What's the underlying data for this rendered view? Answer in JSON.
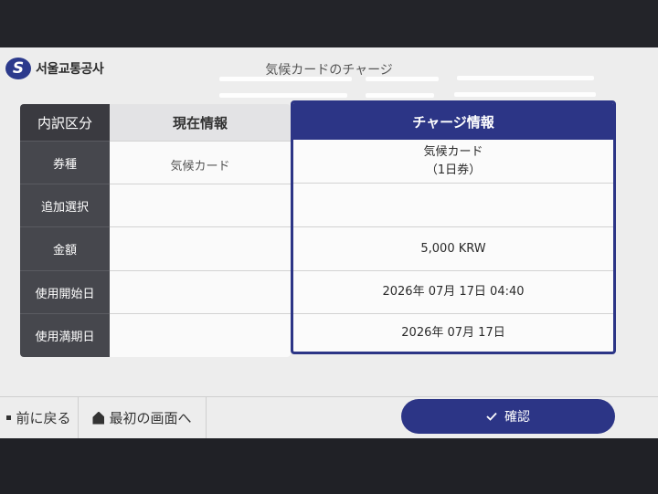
{
  "header": {
    "logo_mark": "S",
    "logo_text": "서울교통공사",
    "title": "気候カードのチャージ"
  },
  "table": {
    "label_header": "内訳区分",
    "current_header": "現在情報",
    "charge_header": "チャージ情報",
    "rows": [
      {
        "label": "券種",
        "current": "気候カード",
        "charge_line1": "気候カード",
        "charge_line2": "（1日券）"
      },
      {
        "label": "追加選択",
        "current": "",
        "charge_line1": "",
        "charge_line2": ""
      },
      {
        "label": "金額",
        "current": "",
        "charge_line1": "5,000 KRW",
        "charge_line2": ""
      },
      {
        "label": "使用開始日",
        "current": "",
        "charge_line1": "2026年 07月 17日 04:40",
        "charge_line2": ""
      },
      {
        "label": "使用満期日",
        "current": "",
        "charge_line1": "2026年 07月 17日",
        "charge_line2": ""
      }
    ]
  },
  "footer": {
    "back_label": "前に戻る",
    "home_label": "最初の画面へ",
    "confirm_label": "確認"
  },
  "colors": {
    "accent": "#2c3586",
    "label_bg": "#46474d"
  }
}
